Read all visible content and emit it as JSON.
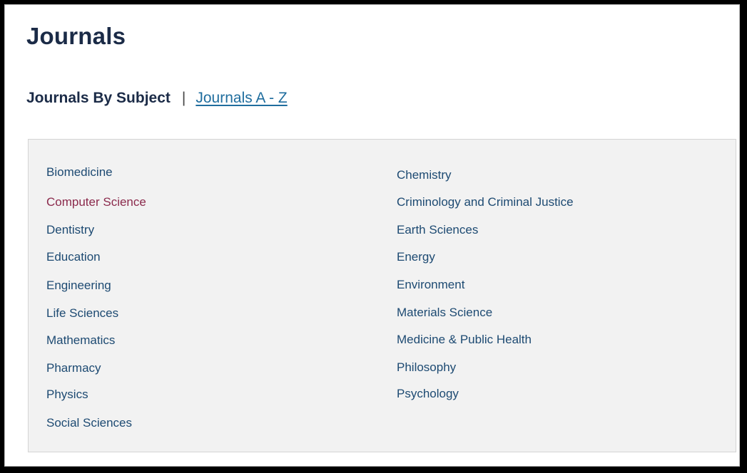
{
  "header": {
    "title": "Journals"
  },
  "subnav": {
    "current": "Journals By Subject",
    "separator": "|",
    "az_link": "Journals A - Z"
  },
  "subjects": {
    "left": [
      "Biomedicine",
      "Computer Science",
      "Dentistry",
      "Education",
      "Engineering",
      "Life Sciences",
      "Mathematics",
      "Pharmacy",
      "Physics",
      "Social Sciences"
    ],
    "right": [
      "Chemistry",
      "Criminology and Criminal Justice",
      "Earth Sciences",
      "Energy",
      "Environment",
      "Materials Science",
      "Medicine & Public Health",
      "Philosophy",
      "Psychology"
    ],
    "visited": "Computer Science"
  },
  "colors": {
    "heading": "#1b2b47",
    "link": "#1d4a72",
    "visited_link": "#8b2a4c",
    "az_link": "#1f6d9e",
    "panel_background": "#f2f2f2"
  }
}
